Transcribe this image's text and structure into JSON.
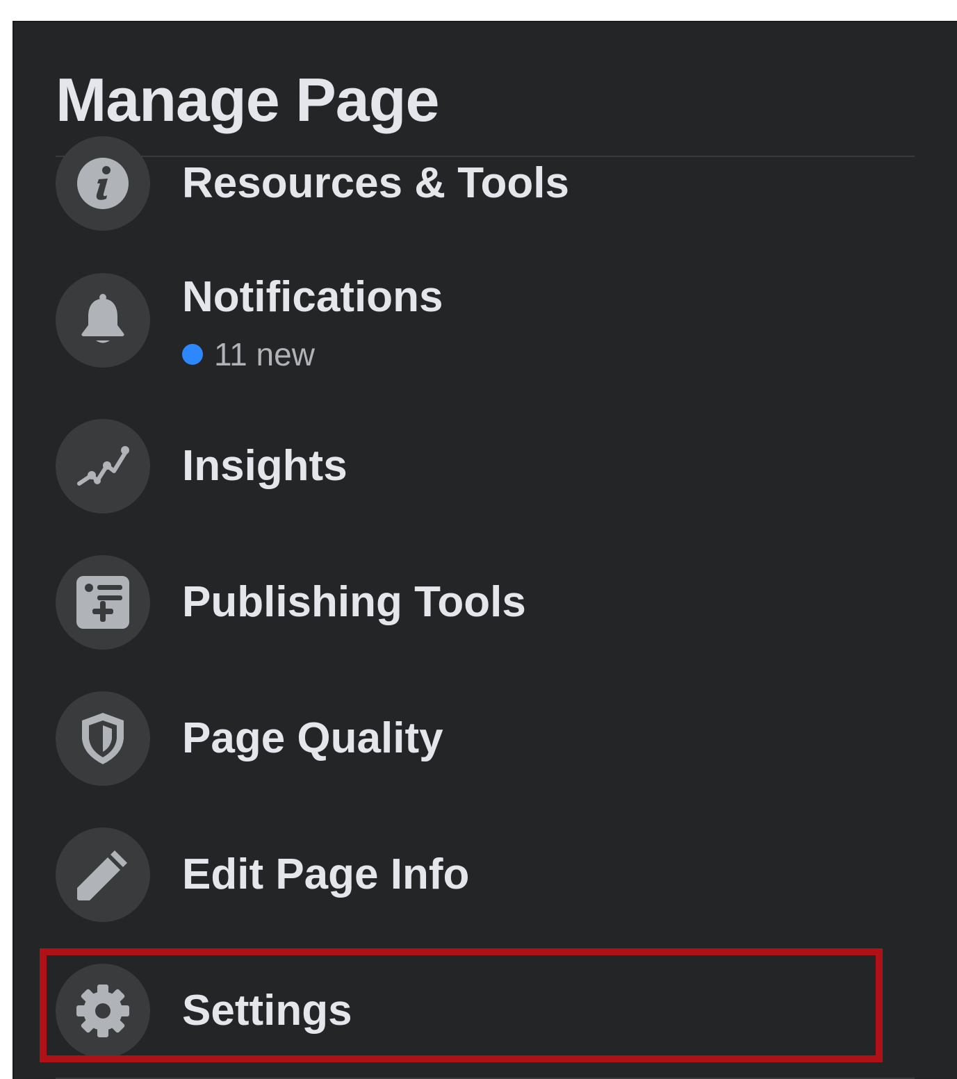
{
  "header": {
    "title": "Manage Page"
  },
  "menu": {
    "items": [
      {
        "id": "resources-tools",
        "label": "Resources & Tools",
        "icon": "info-icon"
      },
      {
        "id": "notifications",
        "label": "Notifications",
        "icon": "bell-icon",
        "sub": "11 new",
        "sub_dot_color": "#2d88ff"
      },
      {
        "id": "insights",
        "label": "Insights",
        "icon": "insights-chart-icon"
      },
      {
        "id": "publishing-tools",
        "label": "Publishing Tools",
        "icon": "publishing-list-icon"
      },
      {
        "id": "page-quality",
        "label": "Page Quality",
        "icon": "shield-icon"
      },
      {
        "id": "edit-page-info",
        "label": "Edit Page Info",
        "icon": "pencil-icon"
      },
      {
        "id": "settings",
        "label": "Settings",
        "icon": "gear-icon",
        "highlighted": true
      }
    ]
  },
  "colors": {
    "panel_bg": "#242526",
    "icon_circle": "#3a3b3c",
    "text_primary": "#e4e6eb",
    "text_secondary": "#b0b3b8",
    "icon_fill": "#b0b3b8",
    "highlight_border": "#b01116",
    "notification_dot": "#2d88ff"
  }
}
